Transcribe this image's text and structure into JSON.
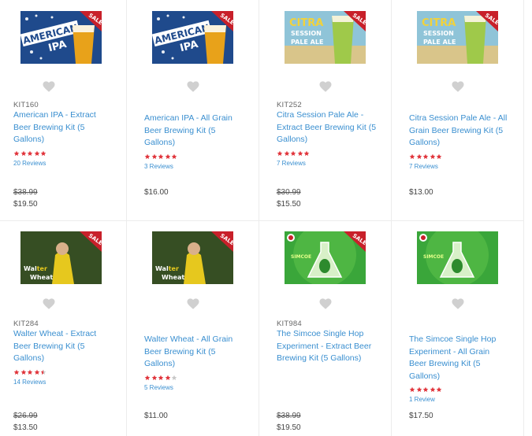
{
  "colors": {
    "link": "#3a8fd0",
    "star": "#e0333a",
    "star_empty": "#c8c8c8",
    "heart": "#d0d0d0"
  },
  "products": [
    {
      "sku": "KIT160",
      "title": "American IPA - Extract Beer Brewing Kit (5 Gallons)",
      "rating": 5,
      "reviews": "20 Reviews",
      "old_price": "$38.99",
      "price": "$19.50",
      "image": "american-ipa-label",
      "sale": true
    },
    {
      "sku": "",
      "title": "American IPA - All Grain Beer Brewing Kit (5 Gallons)",
      "rating": 5,
      "reviews": "3 Reviews",
      "old_price": "",
      "price": "$16.00",
      "image": "american-ipa-label",
      "sale": true
    },
    {
      "sku": "KIT252",
      "title": "Citra Session Pale Ale - Extract Beer Brewing Kit (5 Gallons)",
      "rating": 5,
      "reviews": "7 Reviews",
      "old_price": "$30.99",
      "price": "$15.50",
      "image": "citra-session-label",
      "sale": true
    },
    {
      "sku": "",
      "title": "Citra Session Pale Ale - All Grain Beer Brewing Kit (5 Gallons)",
      "rating": 5,
      "reviews": "7 Reviews",
      "old_price": "",
      "price": "$13.00",
      "image": "citra-session-label",
      "sale": true
    },
    {
      "sku": "KIT284",
      "title": "Walter Wheat - Extract Beer Brewing Kit (5 Gallons)",
      "rating": 4.5,
      "reviews": "14 Reviews",
      "old_price": "$26.99",
      "price": "$13.50",
      "image": "walter-wheat-label",
      "sale": true
    },
    {
      "sku": "",
      "title": "Walter Wheat - All Grain Beer Brewing Kit (5 Gallons)",
      "rating": 4,
      "reviews": "5 Reviews",
      "old_price": "",
      "price": "$11.00",
      "image": "walter-wheat-label",
      "sale": true
    },
    {
      "sku": "KIT984",
      "title": "The Simcoe Single Hop Experiment - Extract Beer Brewing Kit (5 Gallons)",
      "rating": 0,
      "reviews": "",
      "old_price": "$38.99",
      "price": "$19.50",
      "image": "simcoe-hop-label",
      "sale": true
    },
    {
      "sku": "",
      "title": "The Simcoe Single Hop Experiment - All Grain Beer Brewing Kit (5 Gallons)",
      "rating": 5,
      "reviews": "1 Review",
      "old_price": "",
      "price": "$17.50",
      "image": "simcoe-hop-label",
      "sale": false
    }
  ],
  "labels": {
    "american": [
      "AMERICAN",
      "IPA"
    ],
    "citra": [
      "CITRA",
      "SESSION",
      "PALE ALE"
    ],
    "walter": [
      "Wal",
      "ter",
      "Wheat"
    ],
    "simcoe": [
      "SIMCOE"
    ],
    "sale": "SALE"
  }
}
